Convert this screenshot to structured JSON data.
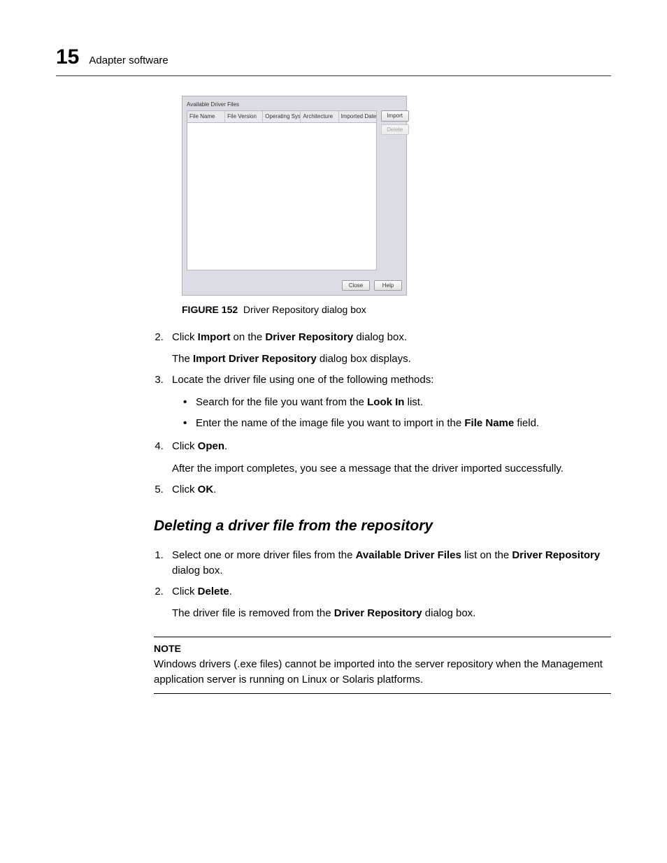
{
  "header": {
    "chapter_number": "15",
    "chapter_title": "Adapter software"
  },
  "dialog": {
    "group_label": "Available Driver Files",
    "columns": {
      "c0": "File Name",
      "c1": "File Version",
      "c2": "Operating System",
      "c3": "Architecture",
      "c4": "Imported Date"
    },
    "buttons": {
      "import": "Import",
      "delete": "Delete",
      "close": "Close",
      "help": "Help"
    }
  },
  "caption": {
    "label": "FIGURE 152",
    "text": "Driver Repository dialog box"
  },
  "steps_import": {
    "s2_a": "Click ",
    "s2_import": "Import",
    "s2_b": " on the ",
    "s2_dr": "Driver Repository",
    "s2_c": " dialog box.",
    "s2_body_a": "The ",
    "s2_body_b": "Import Driver Repository",
    "s2_body_c": " dialog box displays.",
    "s3": "Locate the driver file using one of the following methods:",
    "s3_b1_a": "Search for the file you want from the ",
    "s3_b1_b": "Look In",
    "s3_b1_c": " list.",
    "s3_b2_a": "Enter the name of the image file you want to import in the ",
    "s3_b2_b": "File Name",
    "s3_b2_c": " field.",
    "s4_a": "Click ",
    "s4_b": "Open",
    "s4_c": ".",
    "s4_body": "After the import completes, you see a message that the driver imported successfully.",
    "s5_a": "Click ",
    "s5_b": "OK",
    "s5_c": "."
  },
  "section_heading": "Deleting a driver file from the repository",
  "steps_delete": {
    "s1_a": "Select one or more driver files from the ",
    "s1_b": "Available Driver Files",
    "s1_c": " list on the ",
    "s1_d": "Driver Repository",
    "s1_e": " dialog box.",
    "s2_a": "Click ",
    "s2_b": "Delete",
    "s2_c": ".",
    "s2_body_a": "The driver file is removed from the ",
    "s2_body_b": "Driver Repository",
    "s2_body_c": " dialog box."
  },
  "note": {
    "title": "NOTE",
    "body": "Windows drivers (.exe files) cannot be imported into the server repository when the Management application server is running on Linux or Solaris platforms."
  }
}
